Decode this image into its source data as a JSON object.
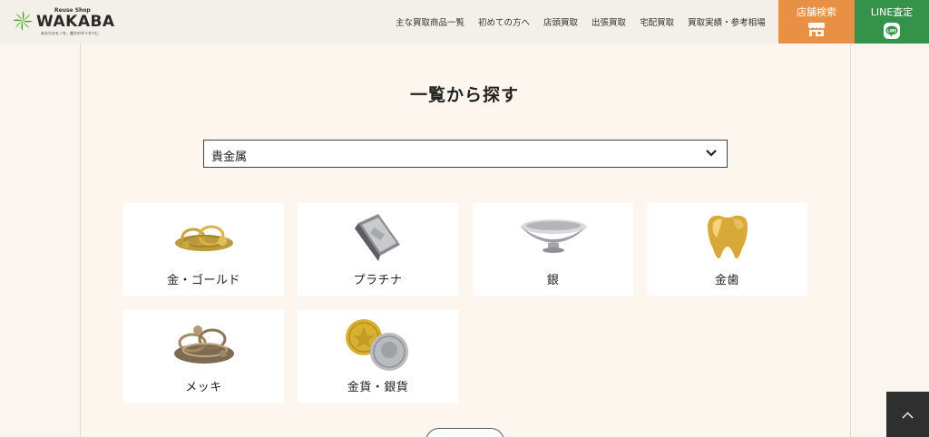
{
  "header": {
    "logo": {
      "top_text": "Reuse Shop",
      "brand": "WAKABA",
      "tagline": "あなたのモノを、誰かのダイセツに"
    },
    "nav": [
      "主な買取商品一覧",
      "初めての方へ",
      "店頭買取",
      "出張買取",
      "宅配買取",
      "買取実績・参考相場"
    ],
    "store_search": {
      "label": "店舗検索",
      "icon": "store-icon",
      "color": "#e89144"
    },
    "line_assess": {
      "label": "LINE査定",
      "icon": "line-icon",
      "color": "#35924a"
    }
  },
  "main": {
    "title": "一覧から探す",
    "category_select": {
      "value": "貴金属"
    },
    "items": [
      {
        "label": "金・ゴールド",
        "icon": "gold-jewelry-image"
      },
      {
        "label": "プラチナ",
        "icon": "platinum-bar-image"
      },
      {
        "label": "銀",
        "icon": "silver-cup-image"
      },
      {
        "label": "金歯",
        "icon": "gold-tooth-image"
      },
      {
        "label": "メッキ",
        "icon": "plated-jewelry-image"
      },
      {
        "label": "金貨・銀貨",
        "icon": "gold-silver-coins-image"
      }
    ]
  },
  "back_to_top": {
    "icon": "chevron-up-icon"
  }
}
